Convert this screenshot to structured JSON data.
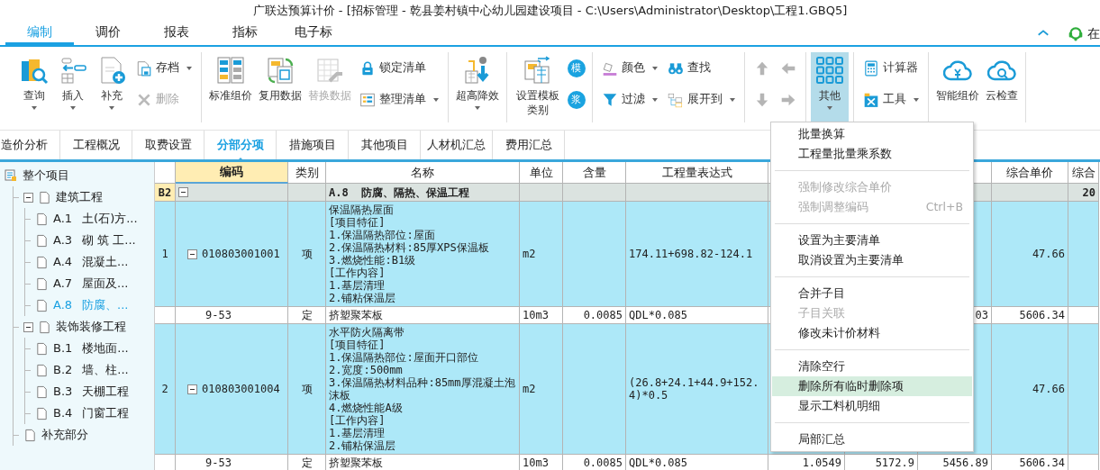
{
  "window": {
    "title": "广联达预算计价 - [招标管理 - 乾县姜村镇中心幼儿园建设项目 - C:\\Users\\Administrator\\Desktop\\工程1.GBQ5]"
  },
  "ribbon_tabs": [
    {
      "label": "编制",
      "selected": true
    },
    {
      "label": "调价",
      "selected": false
    },
    {
      "label": "报表",
      "selected": false
    },
    {
      "label": "指标",
      "selected": false
    },
    {
      "label": "电子标",
      "selected": false
    }
  ],
  "ribbon_right": {
    "label": "在"
  },
  "toolbar": [
    {
      "items": [
        {
          "kind": "large",
          "label": "查询",
          "dropdown": true,
          "disabled": false,
          "pressed": false
        },
        {
          "kind": "large",
          "label": "插入",
          "dropdown": true,
          "disabled": false,
          "pressed": false
        },
        {
          "kind": "large",
          "label": "补充",
          "dropdown": true,
          "disabled": false,
          "pressed": false
        },
        {
          "kind": "small",
          "label": "存档",
          "dropdown": true,
          "disabled": false,
          "pressed": false
        },
        {
          "kind": "small",
          "label": "删除",
          "dropdown": false,
          "disabled": true,
          "pressed": false
        }
      ]
    },
    {
      "items": [
        {
          "kind": "large",
          "label": "标准组价",
          "dropdown": false,
          "disabled": false,
          "pressed": false
        },
        {
          "kind": "large",
          "label": "复用数据",
          "dropdown": false,
          "disabled": false,
          "pressed": false
        },
        {
          "kind": "large",
          "label": "替换数据",
          "dropdown": false,
          "disabled": true,
          "pressed": false
        },
        {
          "kind": "small",
          "label": "锁定清单",
          "dropdown": false,
          "disabled": false,
          "pressed": false
        },
        {
          "kind": "small",
          "label": "整理清单",
          "dropdown": true,
          "disabled": false,
          "pressed": false
        }
      ]
    },
    {
      "items": [
        {
          "kind": "large",
          "label": "超高降效",
          "dropdown": true,
          "disabled": false,
          "pressed": false
        }
      ]
    },
    {
      "items": [
        {
          "kind": "large",
          "label": "设置模板类别",
          "dropdown": false,
          "disabled": false,
          "pressed": false
        },
        {
          "kind": "badge",
          "label": "模",
          "dropdown": false,
          "disabled": false,
          "pressed": false
        },
        {
          "kind": "badge",
          "label": "浆",
          "dropdown": false,
          "disabled": false,
          "pressed": false
        }
      ]
    },
    {
      "items": [
        {
          "kind": "small",
          "label": "颜色",
          "dropdown": true,
          "disabled": false,
          "pressed": false
        },
        {
          "kind": "small",
          "label": "过滤",
          "dropdown": true,
          "disabled": false,
          "pressed": false
        },
        {
          "kind": "small",
          "label": "查找",
          "dropdown": false,
          "disabled": false,
          "pressed": false
        },
        {
          "kind": "small",
          "label": "展开到",
          "dropdown": true,
          "disabled": false,
          "pressed": false
        }
      ]
    },
    {
      "items": [
        {
          "kind": "up",
          "disabled": true
        },
        {
          "kind": "down",
          "disabled": true
        },
        {
          "kind": "left",
          "disabled": true
        },
        {
          "kind": "right",
          "disabled": true
        }
      ]
    },
    {
      "items": [
        {
          "kind": "large",
          "label": "其他",
          "dropdown": true,
          "disabled": false,
          "pressed": true
        }
      ]
    },
    {
      "items": [
        {
          "kind": "small",
          "label": "计算器",
          "dropdown": false,
          "disabled": false,
          "pressed": false
        },
        {
          "kind": "small",
          "label": "工具",
          "dropdown": true,
          "disabled": false,
          "pressed": false
        }
      ]
    },
    {
      "items": [
        {
          "kind": "large",
          "label": "智能组价",
          "dropdown": false,
          "disabled": false,
          "pressed": false
        },
        {
          "kind": "large",
          "label": "云检查",
          "dropdown": false,
          "disabled": false,
          "pressed": false
        }
      ]
    }
  ],
  "sub_tabs": [
    {
      "label": "造价分析",
      "selected": false
    },
    {
      "label": "工程概况",
      "selected": false
    },
    {
      "label": "取费设置",
      "selected": false
    },
    {
      "label": "分部分项",
      "selected": true
    },
    {
      "label": "措施项目",
      "selected": false
    },
    {
      "label": "其他项目",
      "selected": false
    },
    {
      "label": "人材机汇总",
      "selected": false
    },
    {
      "label": "费用汇总",
      "selected": false
    }
  ],
  "tree": {
    "label": "整个项目",
    "selected": false,
    "children": [
      {
        "label": "建筑工程",
        "expanded": true,
        "selected": false,
        "children": [
          {
            "code": "A.1",
            "label": "土(石)方...",
            "selected": false
          },
          {
            "code": "A.3",
            "label": "砌 筑 工...",
            "selected": false
          },
          {
            "code": "A.4",
            "label": "混凝土...",
            "selected": false
          },
          {
            "code": "A.7",
            "label": "屋面及...",
            "selected": false
          },
          {
            "code": "A.8",
            "label": "防腐、...",
            "selected": true
          }
        ]
      },
      {
        "label": "装饰装修工程",
        "expanded": true,
        "selected": false,
        "children": [
          {
            "code": "B.1",
            "label": "楼地面...",
            "selected": false
          },
          {
            "code": "B.2",
            "label": "墙、柱...",
            "selected": false
          },
          {
            "code": "B.3",
            "label": "天棚工程",
            "selected": false
          },
          {
            "code": "B.4",
            "label": "门窗工程",
            "selected": false
          }
        ]
      },
      {
        "label": "补充部分",
        "selected": false
      }
    ]
  },
  "table": {
    "columns": [
      {
        "label": "编码",
        "selected": true
      },
      {
        "label": "类别",
        "selected": false
      },
      {
        "label": "名称",
        "selected": false
      },
      {
        "label": "单位",
        "selected": false
      },
      {
        "label": "含量",
        "selected": false
      },
      {
        "label": "工程量表达式",
        "selected": false
      },
      {
        "label": "综合单价",
        "selected": false
      },
      {
        "label": "综合",
        "selected": false
      }
    ],
    "rows": [
      {
        "kind": "division",
        "number": "B2",
        "expanded": true,
        "name": "A.8  防腐、隔热、保温工程",
        "column_12": "20"
      },
      {
        "kind": "bill",
        "number": "1",
        "expanded": true,
        "code": "010803001001",
        "category": "项",
        "name": "保温隔热屋面\n[项目特征]\n1.保温隔热部位:屋面\n2.保温隔热材料:85厚XPS保温板\n3.燃烧性能:B1级\n[工作内容]\n1.基层清理\n2.铺粘保温层",
        "unit": "m2",
        "expression": "174.11+698.82-124.1",
        "unit_price": "47.66"
      },
      {
        "kind": "norm",
        "code": "9-53",
        "category": "定",
        "name": "挤塑聚苯板",
        "unit": "10m3",
        "quantity": "0.0085",
        "expression": "QDL*0.085",
        "column_10": "03",
        "unit_price": "5606.34"
      },
      {
        "kind": "bill",
        "number": "2",
        "expanded": true,
        "code": "010803001004",
        "category": "项",
        "name": "水平防火隔离带\n[项目特征]\n1.保温隔热部位:屋面开口部位\n2.宽度:500mm\n3.保温隔热材料品种:85mm厚混凝土泡沫板\n4.燃烧性能A级\n[工作内容]\n1.基层清理\n2.铺粘保温层",
        "unit": "m2",
        "expression": "(26.8+24.1+44.9+152.4)*0.5",
        "unit_price": "47.66"
      },
      {
        "kind": "norm",
        "code": "9-53",
        "category": "定",
        "name": "挤塑聚苯板",
        "unit": "10m3",
        "quantity": "0.0085",
        "expression": "QDL*0.085",
        "column_8": "1.0549",
        "column_9": "5172.9",
        "column_10": "5456.89",
        "unit_price": "5606.34"
      }
    ]
  },
  "context_menu": [
    {
      "kind": "item",
      "label": "批量换算",
      "disabled": false,
      "selected": false
    },
    {
      "kind": "item",
      "label": "工程量批量乘系数",
      "disabled": false,
      "selected": false
    },
    {
      "kind": "separator"
    },
    {
      "kind": "item",
      "label": "强制修改综合单价",
      "disabled": true,
      "selected": false
    },
    {
      "kind": "item",
      "label": "强制调整编码",
      "shortcut": "Ctrl+B",
      "disabled": true,
      "selected": false
    },
    {
      "kind": "separator"
    },
    {
      "kind": "item",
      "label": "设置为主要清单",
      "disabled": false,
      "selected": false
    },
    {
      "kind": "item",
      "label": "取消设置为主要清单",
      "disabled": false,
      "selected": false
    },
    {
      "kind": "separator"
    },
    {
      "kind": "item",
      "label": "合并子目",
      "disabled": false,
      "selected": false
    },
    {
      "kind": "item",
      "label": "子目关联",
      "disabled": true,
      "selected": false
    },
    {
      "kind": "item",
      "label": "修改未计价材料",
      "disabled": false,
      "selected": false
    },
    {
      "kind": "separator"
    },
    {
      "kind": "item",
      "label": "清除空行",
      "disabled": false,
      "selected": false
    },
    {
      "kind": "item",
      "label": "删除所有临时删除项",
      "disabled": false,
      "selected": true
    },
    {
      "kind": "item",
      "label": "显示工料机明细",
      "disabled": false,
      "selected": false
    },
    {
      "kind": "separator"
    },
    {
      "kind": "item",
      "label": "局部汇总",
      "disabled": false,
      "selected": false
    }
  ]
}
